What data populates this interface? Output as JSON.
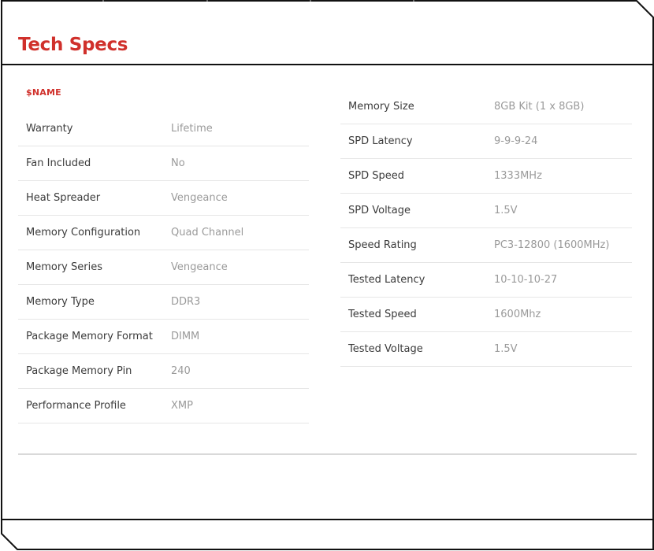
{
  "title": "Tech Specs",
  "name_placeholder": "$NAME",
  "left_specs": [
    {
      "label": "Warranty",
      "value": "Lifetime"
    },
    {
      "label": "Fan Included",
      "value": "No"
    },
    {
      "label": "Heat Spreader",
      "value": "Vengeance"
    },
    {
      "label": "Memory Configuration",
      "value": "Quad Channel"
    },
    {
      "label": "Memory Series",
      "value": "Vengeance"
    },
    {
      "label": "Memory Type",
      "value": "DDR3"
    },
    {
      "label": "Package Memory Format",
      "value": "DIMM"
    },
    {
      "label": "Package Memory Pin",
      "value": "240"
    },
    {
      "label": "Performance Profile",
      "value": "XMP"
    }
  ],
  "right_specs": [
    {
      "label": "Memory Size",
      "value": "8GB Kit (1 x 8GB)"
    },
    {
      "label": "SPD Latency",
      "value": "9-9-9-24"
    },
    {
      "label": "SPD Speed",
      "value": "1333MHz"
    },
    {
      "label": "SPD Voltage",
      "value": "1.5V"
    },
    {
      "label": "Speed Rating",
      "value": "PC3-12800 (1600MHz)"
    },
    {
      "label": "Tested Latency",
      "value": "10-10-10-27"
    },
    {
      "label": "Tested Speed",
      "value": "1600Mhz"
    },
    {
      "label": "Tested Voltage",
      "value": "1.5V"
    }
  ],
  "colors": {
    "accent": "#d0302b",
    "label_text": "#3b3b3b",
    "value_text": "#9a9a9a",
    "row_border": "#e6e6e6"
  }
}
